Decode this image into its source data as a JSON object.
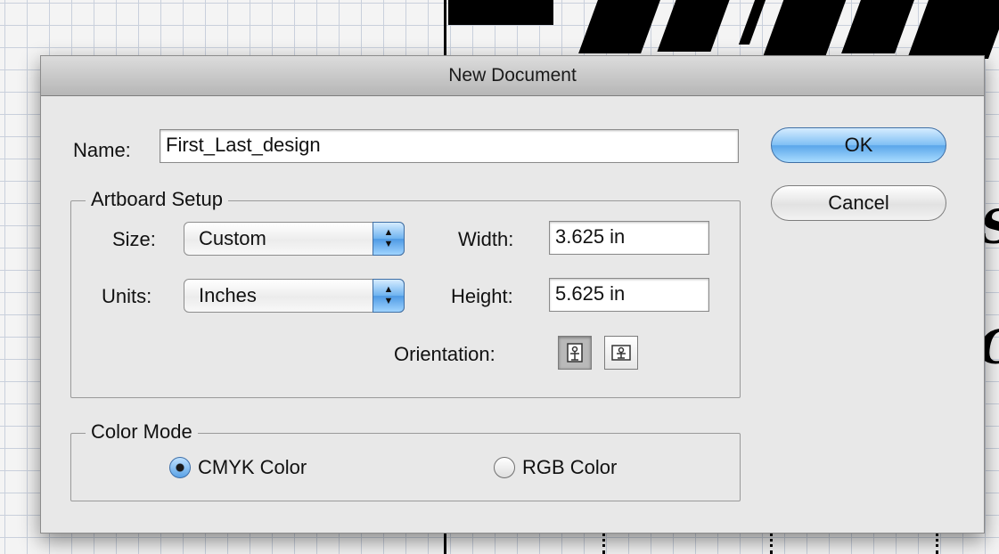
{
  "dialog": {
    "title": "New Document",
    "name_label": "Name:",
    "name_value": "First_Last_design",
    "ok_label": "OK",
    "cancel_label": "Cancel"
  },
  "artboard": {
    "group_title": "Artboard Setup",
    "size_label": "Size:",
    "size_value": "Custom",
    "units_label": "Units:",
    "units_value": "Inches",
    "width_label": "Width:",
    "width_value": "3.625 in",
    "height_label": "Height:",
    "height_value": "5.625 in",
    "orientation_label": "Orientation:",
    "orientation_selected": "portrait"
  },
  "color_mode": {
    "group_title": "Color Mode",
    "options": [
      {
        "label": "CMYK Color",
        "selected": true
      },
      {
        "label": "RGB Color",
        "selected": false
      }
    ]
  },
  "icons": [
    "select-stepper-icon",
    "portrait-orientation-icon",
    "landscape-orientation-icon"
  ]
}
